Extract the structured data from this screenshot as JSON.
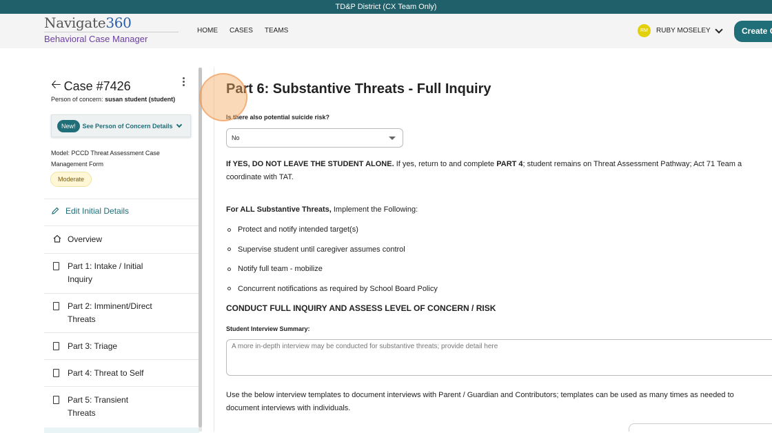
{
  "banner": {
    "text": "TD&P District (CX Team Only)"
  },
  "header": {
    "logo_main": "Navigate",
    "logo_num": "360",
    "logo_sub": "Behavioral Case Manager",
    "nav": [
      "HOME",
      "CASES",
      "TEAMS"
    ],
    "user_initials": "RM",
    "user_name": "RUBY MOSELEY",
    "create_label": "Create C"
  },
  "sidebar": {
    "case_title": "Case #7426",
    "poc_label": "Person of concern:",
    "poc_value": "susan student (student)",
    "new_pill": "New!",
    "poc_link": "See Person of Concern Details",
    "model": "Model: PCCD Threat Assessment Case Management Form",
    "badge": "Moderate",
    "edit_label": "Edit Initial Details",
    "items": [
      {
        "label": "Overview"
      },
      {
        "label": "Part 1: Intake / Initial Inquiry"
      },
      {
        "label": "Part 2: Imminent/Direct Threats"
      },
      {
        "label": "Part 3: Triage"
      },
      {
        "label": "Part 4: Threat to Self"
      },
      {
        "label": "Part 5: Transient Threats"
      }
    ]
  },
  "main": {
    "title": "Part 6: Substantive Threats - Full Inquiry",
    "q_label": "Is there also potential suicide risk?",
    "select_value": "No",
    "p1_bold": "If YES, DO NOT LEAVE THE STUDENT ALONE.",
    "p1_text": " If yes, return to and complete ",
    "p1_bold2": "PART 4",
    "p1_text2": "; student remains on Threat Assessment Pathway; Act 71 Team a",
    "p1_line2": "coordinate with TAT.",
    "p2_bold": "For ALL Substantive Threats,",
    "p2_text": " Implement the Following:",
    "bullets": [
      "Protect and notify intended target(s)",
      "Supervise student until caregiver assumes control",
      "Notify full team - mobilize",
      "Concurrent notifications as required by School Board Policy"
    ],
    "section": "CONDUCT FULL INQUIRY AND ASSESS LEVEL OF CONCERN / RISK",
    "interview_label": "Student Interview Summary:",
    "interview_placeholder": "A more in-depth interview may be conducted for substantive threats; provide detail here",
    "p3_line1": "Use the below interview templates to document interviews with Parent / Guardian and Contributors; templates can be used as many times as needed to",
    "p3_line2": "document interviews with individuals."
  }
}
